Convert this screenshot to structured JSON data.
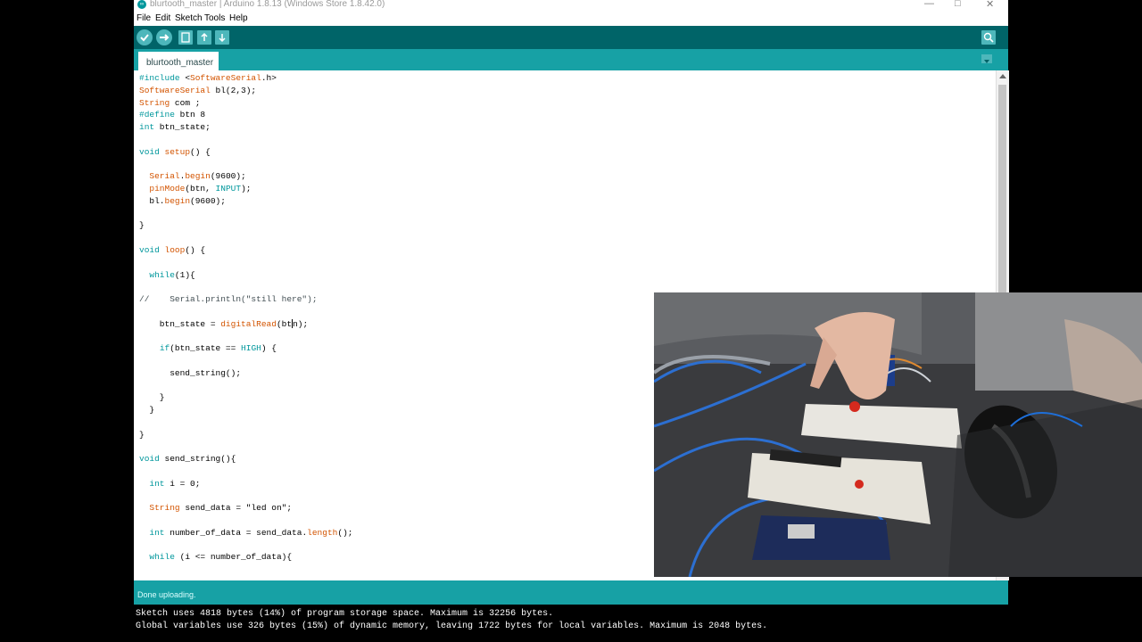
{
  "window": {
    "title": "blurtooth_master | Arduino 1.8.13 (Windows Store 1.8.42.0)",
    "controls": [
      "—",
      "□",
      "✕"
    ]
  },
  "menu": [
    "File",
    "Edit",
    "Sketch",
    "Tools",
    "Help"
  ],
  "toolbar": {
    "buttons": [
      "verify-icon",
      "upload-icon",
      "new-icon",
      "open-icon",
      "save-icon"
    ],
    "serial_monitor": "serial-monitor-icon"
  },
  "tab": {
    "label": "blurtooth_master"
  },
  "code_lines": [
    [
      [
        "kw",
        "#include "
      ],
      [
        "",
        "<"
      ],
      [
        "fn",
        "SoftwareSerial"
      ],
      [
        "",
        ".h>"
      ]
    ],
    [
      [
        "fn",
        "SoftwareSerial"
      ],
      [
        "",
        " bl(2,3);"
      ]
    ],
    [
      [
        "fn",
        "String"
      ],
      [
        "",
        " com ;"
      ]
    ],
    [
      [
        "kw",
        "#define"
      ],
      [
        "",
        " btn 8"
      ]
    ],
    [
      [
        "kw",
        "int"
      ],
      [
        "",
        " btn_state;"
      ]
    ],
    [],
    [
      [
        "kw",
        "void"
      ],
      [
        "",
        " "
      ],
      [
        "fn",
        "setup"
      ],
      [
        "",
        "() {"
      ]
    ],
    [],
    [
      [
        "",
        "  "
      ],
      [
        "fn",
        "Serial"
      ],
      [
        "",
        "."
      ],
      [
        "fn",
        "begin"
      ],
      [
        "",
        "(9600);"
      ]
    ],
    [
      [
        "",
        "  "
      ],
      [
        "fn",
        "pinMode"
      ],
      [
        "",
        "(btn, "
      ],
      [
        "kw",
        "INPUT"
      ],
      [
        "",
        ");"
      ]
    ],
    [
      [
        "",
        "  bl."
      ],
      [
        "fn",
        "begin"
      ],
      [
        "",
        "(9600);"
      ]
    ],
    [],
    [
      [
        "",
        "}"
      ]
    ],
    [],
    [
      [
        "kw",
        "void"
      ],
      [
        "",
        " "
      ],
      [
        "fn",
        "loop"
      ],
      [
        "",
        "() {"
      ]
    ],
    [],
    [
      [
        "",
        "  "
      ],
      [
        "kw",
        "while"
      ],
      [
        "",
        "(1){"
      ]
    ],
    [],
    [
      [
        "cm",
        "//    Serial.println(\"still here\");"
      ]
    ],
    [],
    [
      [
        "",
        "    btn_state = "
      ],
      [
        "fn",
        "digitalRead"
      ],
      [
        "",
        "(bt"
      ],
      [
        "cursor",
        ""
      ],
      [
        "",
        "n);"
      ]
    ],
    [],
    [
      [
        "",
        "    "
      ],
      [
        "kw",
        "if"
      ],
      [
        "",
        "(btn_state == "
      ],
      [
        "kw",
        "HIGH"
      ],
      [
        "",
        ") {"
      ]
    ],
    [],
    [
      [
        "",
        "      send_string();"
      ]
    ],
    [],
    [
      [
        "",
        "    }"
      ]
    ],
    [
      [
        "",
        "  }"
      ]
    ],
    [],
    [
      [
        "",
        "}"
      ]
    ],
    [],
    [
      [
        "kw",
        "void"
      ],
      [
        "",
        " send_string(){"
      ]
    ],
    [],
    [
      [
        "",
        "  "
      ],
      [
        "kw",
        "int"
      ],
      [
        "",
        " i = 0;"
      ]
    ],
    [],
    [
      [
        "",
        "  "
      ],
      [
        "fn",
        "String"
      ],
      [
        "",
        " send_data = \"led on\";"
      ]
    ],
    [],
    [
      [
        "",
        "  "
      ],
      [
        "kw",
        "int"
      ],
      [
        "",
        " number_of_data = send_data."
      ],
      [
        "fn",
        "length"
      ],
      [
        "",
        "();"
      ]
    ],
    [],
    [
      [
        "",
        "  "
      ],
      [
        "kw",
        "while"
      ],
      [
        "",
        " (i <= number_of_data){"
      ]
    ]
  ],
  "status": {
    "text": "Done uploading."
  },
  "console": [
    "Sketch uses 4818 bytes (14%) of program storage space. Maximum is 32256 bytes.",
    "Global variables use 326 bytes (15%) of dynamic memory, leaving 1722 bytes for local variables. Maximum is 2048 bytes."
  ],
  "colors": {
    "toolbar": "#006468",
    "tabbar": "#17a1a5",
    "keyword": "#00979c",
    "function": "#d35400"
  }
}
